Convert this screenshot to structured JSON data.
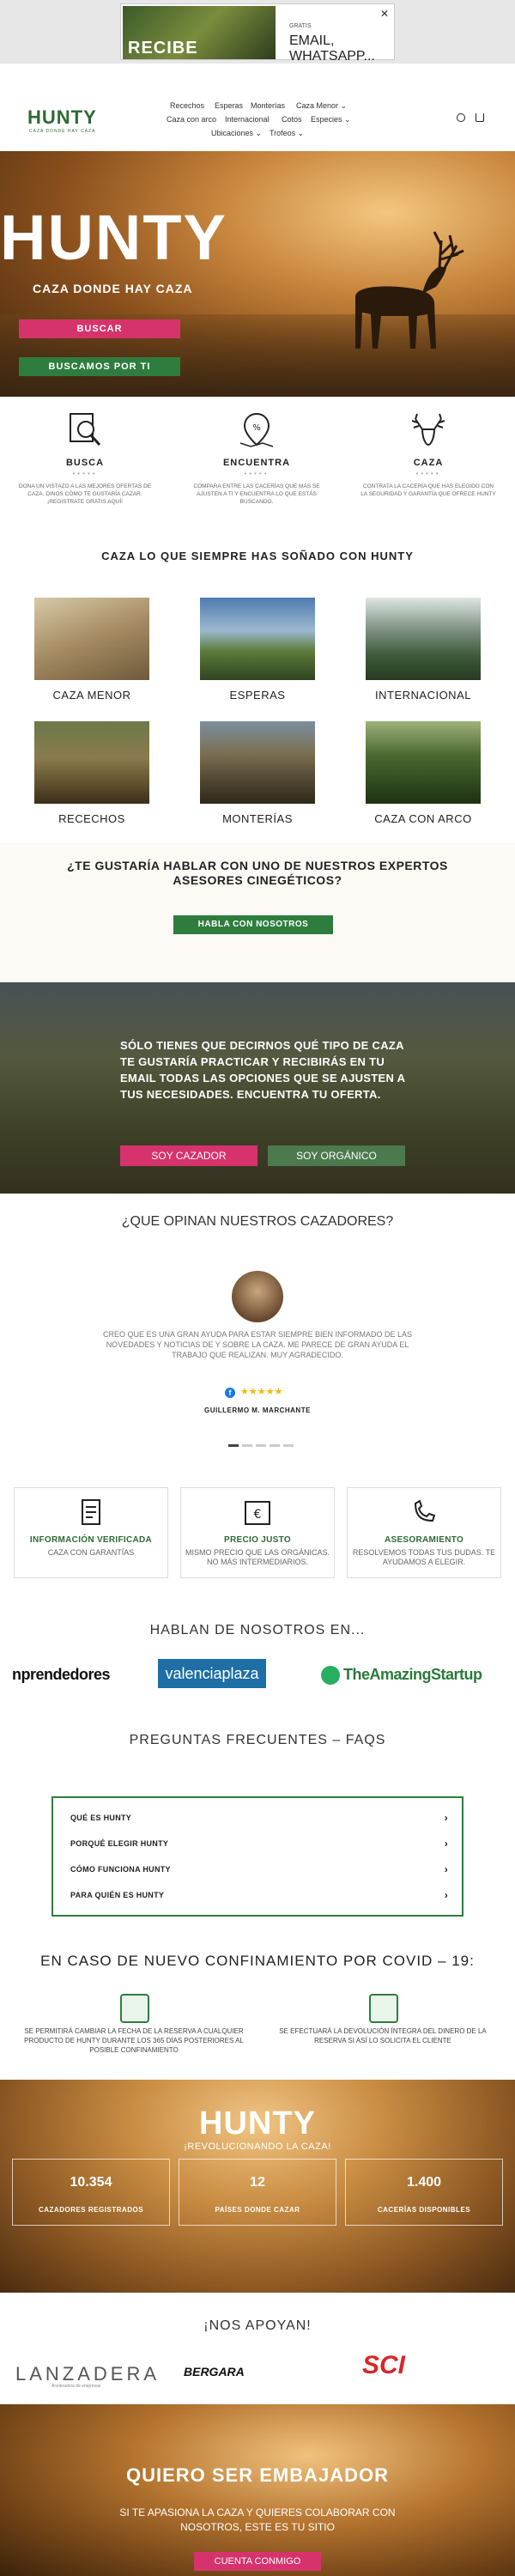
{
  "ad": {
    "image_text": "RECIBE",
    "small": "GRATIS",
    "line1": "EMAIL,",
    "line2": "WHATSAPP...",
    "close": "✕"
  },
  "header": {
    "logo": "HUNTY",
    "logo_sub": "CAZA DONDE HAY CAZA",
    "nav": [
      "Recechos",
      "Esperas",
      "Monterías",
      "Caza Menor ⌄",
      "Caza con arco",
      "Internacional",
      "Cotos",
      "Especies ⌄",
      "Ubicaciones ⌄",
      "Trofeos ⌄"
    ],
    "search_icon": "search-icon",
    "cart_icon": "cart-icon"
  },
  "hero": {
    "title": "HUNTY",
    "tagline": "CAZA DONDE HAY CAZA",
    "btn_buscar": "BUSCAR",
    "btn_buscamos": "BUSCAMOS POR TI"
  },
  "features": [
    {
      "title": "BUSCA",
      "icon": "search-icon",
      "dots": "•••••",
      "desc": "DONA UN VISTAZO A LAS MEJORES OFERTAS DE CAZA. DINOS CÓMO TE GUSTARÍA CAZAR. ¡REGISTRATE GRATIS AQUÍ!"
    },
    {
      "title": "ENCUENTRA",
      "icon": "map-pin-icon",
      "dots": "•••••",
      "desc": "COMPARA ENTRE LAS CACERÍAS QUE MÁS SE AJUSTEN A TI Y ENCUENTRA LO QUE ESTÁS BUSCANDO."
    },
    {
      "title": "CAZA",
      "icon": "deer-antlers-icon",
      "dots": "•••••",
      "desc": "CONTRATA LA CACERÍA QUE HAS ELEGIDO CON LA SEGURIDAD Y GARANTÍA QUE OFRECE HUNTY"
    }
  ],
  "categories_title": "CAZA LO QUE SIEMPRE HAS SOÑADO CON HUNTY",
  "categories": [
    "CAZA MENOR",
    "ESPERAS",
    "INTERNACIONAL",
    "RECECHOS",
    "MONTERÍAS",
    "CAZA CON ARCO"
  ],
  "experts": {
    "title": "¿TE GUSTARÍA HABLAR CON UNO DE NUESTROS EXPERTOS ASESORES CINEGÉTICOS?",
    "button": "HABLA CON NOSOTROS"
  },
  "hunters": {
    "text": "SÓLO TIENES QUE DECIRNOS QUÉ TIPO DE CAZA TE GUSTARÍA PRACTICAR Y RECIBIRÁS EN TU EMAIL TODAS LAS OPCIONES QUE SE AJUSTEN A TUS NECESIDADES. ENCUENTRA TU OFERTA.",
    "btn_cazador": "SOY CAZADOR",
    "btn_organico": "SOY ORGÁNICO"
  },
  "reviews": {
    "title": "¿QUE OPINAN NUESTROS CAZADORES?",
    "text": "CREO QUE ES UNA GRAN AYUDA PARA ESTAR SIEMPRE BIEN INFORMADO DE LAS NOVEDADES Y NOTICIAS DE Y SOBRE LA CAZA. ME PARECE DE GRAN AYUDA EL TRABAJO QUE REALIZAN. MUY AGRADECIDO.",
    "fb": "f",
    "stars": "★★★★★",
    "name": "GUILLERMO M. MARCHANTE"
  },
  "guarantees": [
    {
      "title": "INFORMACIÓN VERIFICADA",
      "desc": "CAZA CON GARANTÍAS",
      "icon": "checklist-icon"
    },
    {
      "title": "PRECIO JUSTO",
      "desc": "MISMO PRECIO QUE LAS ORGÁNICAS. NO MÁS INTERMEDIARIOS.",
      "icon": "price-icon"
    },
    {
      "title": "ASESORAMIENTO",
      "desc": "RESOLVEMOS TODAS TUS DUDAS. TE AYUDAMOS A ELEGIR.",
      "icon": "phone-icon"
    }
  ],
  "press": {
    "title": "HABLAN DE NOSOTROS EN...",
    "emp": "nprendedores",
    "vp": "valenciaplaza",
    "tas": "TheAmazingStartup"
  },
  "faq": {
    "title": "PREGUNTAS FRECUENTES – FAQS",
    "items": [
      "QUÉ ES HUNTY",
      "PORQUÉ ELEGIR HUNTY",
      "CÓMO FUNCIONA HUNTY",
      "PARA QUIÉN ES HUNTY"
    ],
    "chevron": "›"
  },
  "covid": {
    "title": "EN CASO DE NUEVO CONFINAMIENTO POR COVID – 19:",
    "left": "SE PERMITIRÁ CAMBIAR LA FECHA DE LA RESERVA A CUALQUIER PRODUCTO DE HUNTY DURANTE LOS 365 DÍAS POSTERIORES AL POSIBLE CONFINAMIENTO",
    "right": "SE EFECTUARÁ LA DEVOLUCIÓN ÍNTEGRA DEL DINERO DE LA RESERVA SI ASÍ LO SOLICITA EL CLIENTE"
  },
  "stats": {
    "title": "HUNTY",
    "sub": "¡REVOLUCIONANDO LA CAZA!",
    "items": [
      {
        "num": "10.354",
        "label": "CAZADORES REGISTRADOS"
      },
      {
        "num": "12",
        "label": "PAÍSES DONDE CAZAR"
      },
      {
        "num": "1.400",
        "label": "CACERÍAS DISPONIBLES"
      }
    ]
  },
  "support": {
    "title": "¡NOS APOYAN!",
    "lanz": "LANZADERA",
    "lanz_sub": "Aceleradora de empresas",
    "berg": "BERGARA",
    "sci": "SCI"
  },
  "ambassador": {
    "title": "QUIERO SER EMBAJADOR",
    "text": "SI TE APASIONA LA CAZA Y QUIERES COLABORAR CON NOSOTROS, ESTE ES TU SITIO",
    "button": "CUENTA CONMIGO"
  }
}
